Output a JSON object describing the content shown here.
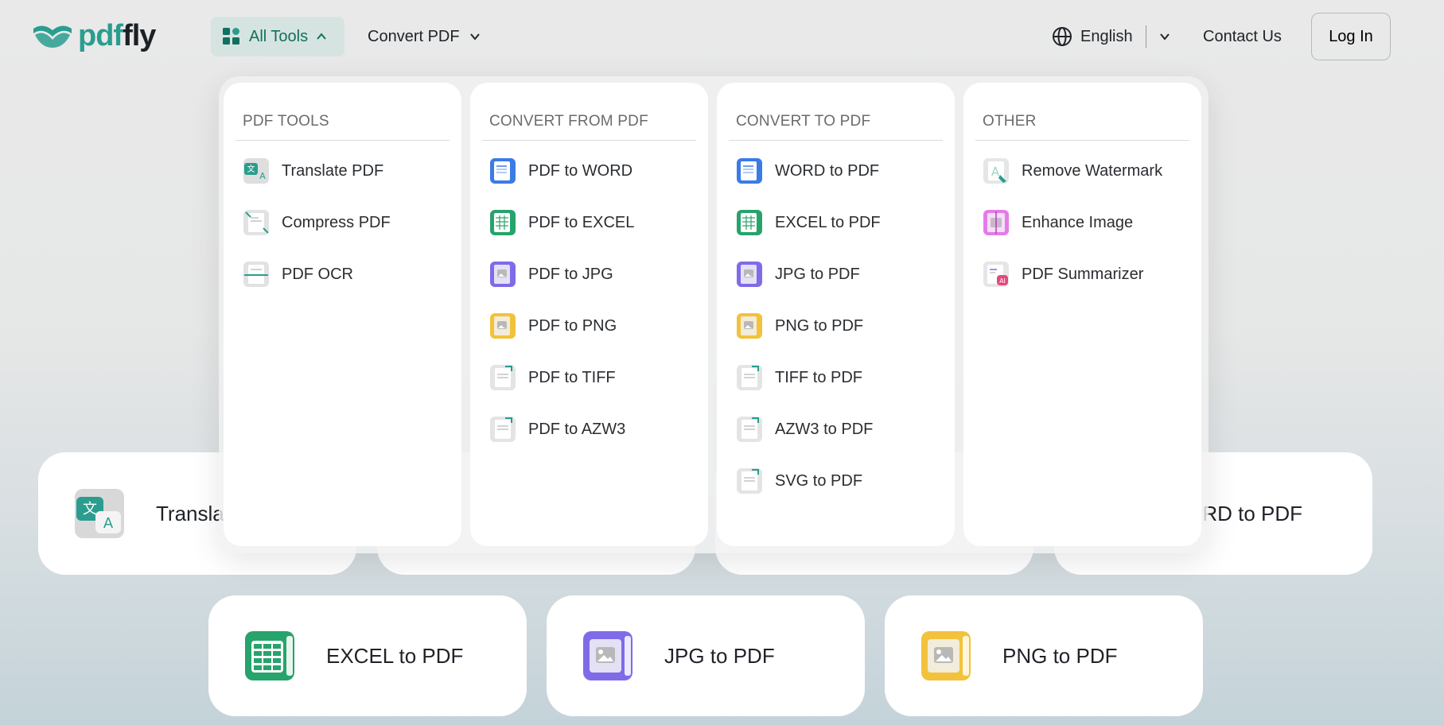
{
  "brand": {
    "name_prefix": "pdf",
    "name_suffix": "fly",
    "primary_color": "#2a9d8f"
  },
  "nav": {
    "all_tools": "All Tools",
    "convert_pdf": "Convert PDF",
    "language": "English",
    "contact": "Contact Us",
    "login": "Log In"
  },
  "dropdown": {
    "columns": [
      {
        "title": "PDF TOOLS",
        "items": [
          {
            "label": "Translate PDF",
            "icon": "translate-icon"
          },
          {
            "label": "Compress PDF",
            "icon": "compress-icon"
          },
          {
            "label": "PDF OCR",
            "icon": "ocr-icon"
          }
        ]
      },
      {
        "title": "CONVERT FROM PDF",
        "items": [
          {
            "label": "PDF to WORD",
            "icon": "word-icon"
          },
          {
            "label": "PDF to EXCEL",
            "icon": "excel-icon"
          },
          {
            "label": "PDF to JPG",
            "icon": "jpg-icon"
          },
          {
            "label": "PDF to PNG",
            "icon": "png-icon"
          },
          {
            "label": "PDF to TIFF",
            "icon": "tiff-icon"
          },
          {
            "label": "PDF to AZW3",
            "icon": "azw3-icon"
          }
        ]
      },
      {
        "title": "CONVERT TO PDF",
        "items": [
          {
            "label": "WORD to PDF",
            "icon": "word-icon"
          },
          {
            "label": "EXCEL to PDF",
            "icon": "excel-icon"
          },
          {
            "label": "JPG to PDF",
            "icon": "jpg-icon"
          },
          {
            "label": "PNG to PDF",
            "icon": "png-icon"
          },
          {
            "label": "TIFF to PDF",
            "icon": "tiff-icon"
          },
          {
            "label": "AZW3 to PDF",
            "icon": "azw3-icon"
          },
          {
            "label": "SVG to PDF",
            "icon": "svg-icon"
          }
        ]
      },
      {
        "title": "OTHER",
        "items": [
          {
            "label": "Remove Watermark",
            "icon": "watermark-icon"
          },
          {
            "label": "Enhance Image",
            "icon": "enhance-icon"
          },
          {
            "label": "PDF Summarizer",
            "icon": "summarizer-icon"
          }
        ]
      }
    ]
  },
  "cards": {
    "row1_left": "Transla",
    "row1_right": "RD to PDF",
    "excel": "EXCEL to PDF",
    "jpg": "JPG to PDF",
    "png": "PNG to PDF"
  }
}
